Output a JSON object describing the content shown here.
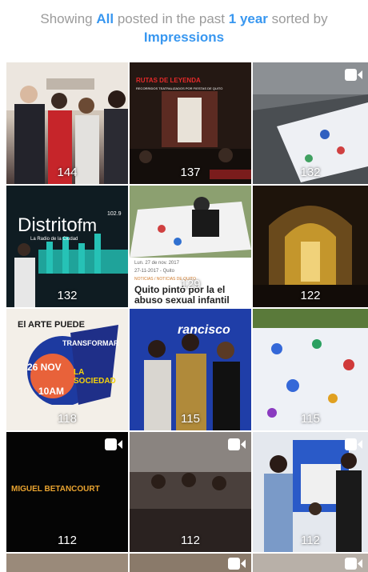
{
  "header": {
    "prefix": "Showing",
    "filter_all": "All",
    "middle": "posted in the past",
    "period": "1 year",
    "suffix": "sorted by",
    "sort": "Impressions"
  },
  "posts": [
    {
      "count": "144",
      "video": false
    },
    {
      "count": "137",
      "video": false,
      "title": "RUTAS DE LEYENDA",
      "subtitle": "RECORRIDOS TEATRALIZADOS POR FIESTAS DE QUITO"
    },
    {
      "count": "132",
      "video": true,
      "icon": "video-camera-icon"
    },
    {
      "count": "132",
      "video": false,
      "brand": "Distrito",
      "brand_suffix": "fm",
      "freq": "102.9",
      "tagline": "La Radio de la Ciudad"
    },
    {
      "count": "129",
      "video": false,
      "date": "Lun. 27 de nov. 2017",
      "date2": "27-11-2017 - Quito",
      "tags": "NOTICIAS / NOTICIAS DE QUITO",
      "headline": "Quito pintó por la el abuso sexual infantil"
    },
    {
      "count": "122",
      "video": false
    },
    {
      "count": "118",
      "video": false,
      "art1": "El ARTE PUEDE",
      "art2": "TRANSFORMAR",
      "art3": "26 NOV",
      "art4": "LA SOCIEDAD",
      "art5": "10AM"
    },
    {
      "count": "115",
      "video": false,
      "banner": "rancisco"
    },
    {
      "count": "115",
      "video": false
    },
    {
      "count": "112",
      "video": true,
      "icon": "video-camera-icon",
      "name": "MIGUEL BETANCOURT"
    },
    {
      "count": "112",
      "video": true,
      "icon": "video-camera-icon"
    },
    {
      "count": "112",
      "video": true,
      "icon": "video-camera-icon"
    }
  ],
  "colors": {
    "link": "#3897f0",
    "muted": "#9b9b9b",
    "count": "#ffffff"
  }
}
